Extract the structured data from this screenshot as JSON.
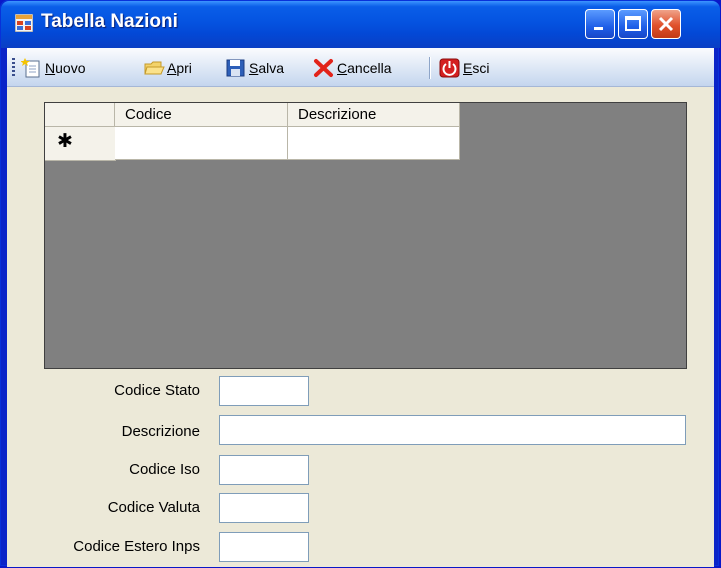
{
  "window": {
    "title": "Tabella Nazioni"
  },
  "toolbar": {
    "items": [
      {
        "label_u": "N",
        "label_rest": "uovo",
        "icon": "new-document-icon"
      },
      {
        "label_u": "A",
        "label_rest": "pri",
        "icon": "open-folder-icon"
      },
      {
        "label_u": "S",
        "label_rest": "alva",
        "icon": "save-disk-icon"
      },
      {
        "label_u": "C",
        "label_rest": "ancella",
        "icon": "delete-x-icon"
      },
      {
        "label_u": "E",
        "label_rest": "sci",
        "icon": "exit-power-icon"
      }
    ]
  },
  "grid": {
    "columns": [
      "Codice",
      "Descrizione"
    ],
    "new_row_marker": "✱"
  },
  "form": {
    "fields": [
      {
        "label": "Codice Stato",
        "value": ""
      },
      {
        "label": "Descrizione",
        "value": ""
      },
      {
        "label": "Codice Iso",
        "value": ""
      },
      {
        "label": "Codice Valuta",
        "value": ""
      },
      {
        "label": "Codice Estero Inps",
        "value": ""
      }
    ]
  },
  "colors": {
    "titlebar": "#0555e2",
    "client_bg": "#ece9d8",
    "grid_bg": "#808080",
    "close_button": "#e0512b"
  }
}
